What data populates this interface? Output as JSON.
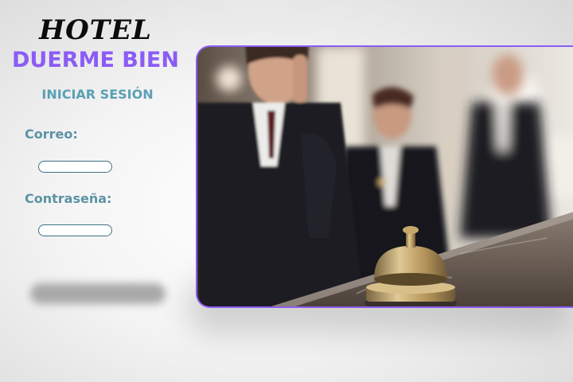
{
  "brand": {
    "line1": "HOTEL",
    "line2": "DUERME BIEN",
    "accent_color": "#8b5cf6"
  },
  "login": {
    "heading": "INICIAR SESIÓN",
    "email_label": "Correo:",
    "email_value": "",
    "password_label": "Contraseña:",
    "password_value": "",
    "submit_label": ""
  },
  "hero_image": {
    "icon": "hotel-reception-photo"
  }
}
